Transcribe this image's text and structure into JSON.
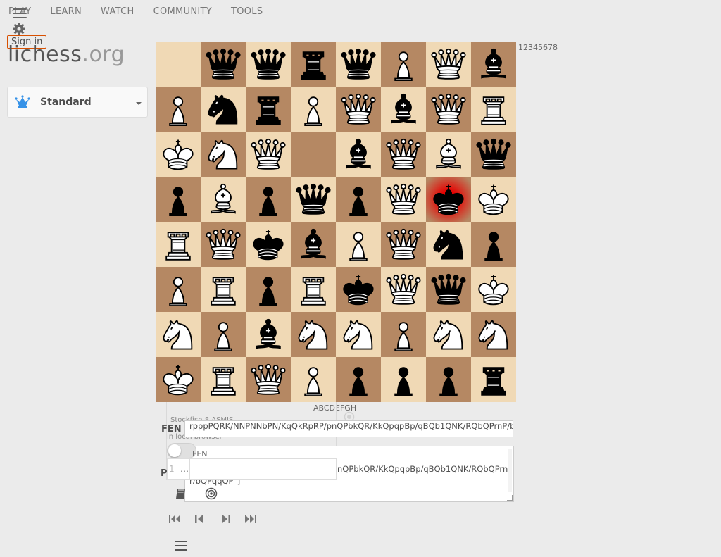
{
  "nav": {
    "items": [
      "PLAY",
      "LEARN",
      "WATCH",
      "COMMUNITY",
      "TOOLS"
    ],
    "sign_in": "Sign in"
  },
  "logo": {
    "name": "lichess",
    "tld": ".org"
  },
  "variant": {
    "selected": "Standard"
  },
  "board": {
    "ranks_label": "12345678",
    "files_label": "ABCDEFGH",
    "rows": [
      [
        "",
        "bq",
        "bq",
        "br",
        "bq",
        "wp",
        "wq",
        "bb"
      ],
      [
        "wp",
        "bn",
        "br",
        "wp",
        "wq",
        "bb",
        "wq",
        "wr"
      ],
      [
        "wk",
        "wn",
        "wq",
        "",
        "bb",
        "wq",
        "wb",
        "bq"
      ],
      [
        "bp",
        "wb",
        "bp",
        "bq",
        "bp",
        "wq",
        "bk",
        "wk"
      ],
      [
        "wr",
        "wq",
        "bk",
        "bb",
        "wp",
        "wq",
        "bn",
        "bp"
      ],
      [
        "wp",
        "wr",
        "bp",
        "wr",
        "bk",
        "wq",
        "bq",
        "wk"
      ],
      [
        "wn",
        "wp",
        "bb",
        "wn",
        "wn",
        "wp",
        "wn",
        "wn"
      ],
      [
        "wk",
        "wr",
        "wq",
        "wp",
        "bp",
        "bp",
        "bp",
        "br"
      ]
    ],
    "check_square": [
      3,
      6
    ]
  },
  "engine": {
    "name": "Stockfish 8 ASMJS",
    "location": "in local browser",
    "move_number": "1",
    "move_placeholder": "…"
  },
  "fen": {
    "label": "FEN",
    "value": "rpppPQRK/NNPNNbPN/KqQkRpRP/pnQPbkQR/KkQpqpBp/qBQb1QNK/RQbQPrnP/b",
    "sub_label": "FEN"
  },
  "pgn": {
    "label": "PGN",
    "text_line1": "nQPbkQR/KkQpqpBp/qBQb1QNK/RQbQPrn",
    "text_line2": "r/bQPqqQP\"]"
  },
  "icons": {
    "menu": "hamburger-icon",
    "settings": "gear-icon",
    "variant": "crown-icon",
    "book": "book-icon",
    "target": "target-icon"
  }
}
